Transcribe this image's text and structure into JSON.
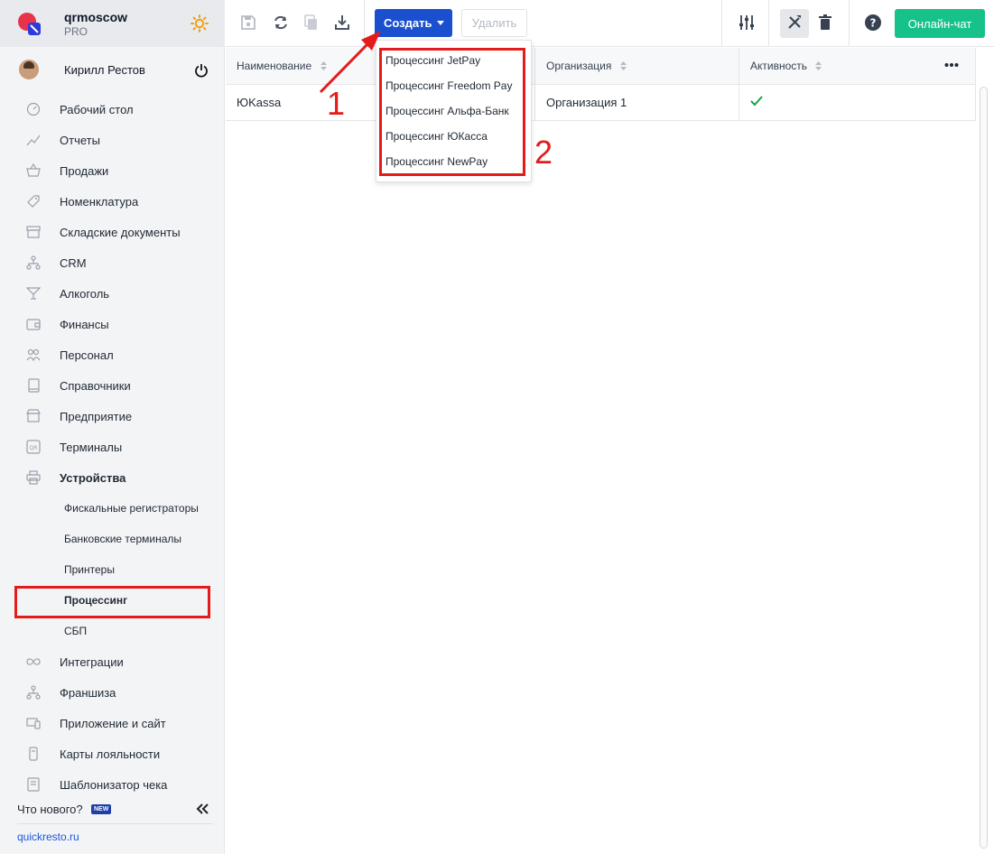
{
  "brand": {
    "name": "qrmoscow",
    "plan": "PRO"
  },
  "user": {
    "name": "Кирилл Рестов"
  },
  "nav": {
    "items": [
      {
        "label": "Рабочий стол",
        "icon": "dashboard-icon"
      },
      {
        "label": "Отчеты",
        "icon": "chart-icon"
      },
      {
        "label": "Продажи",
        "icon": "basket-icon"
      },
      {
        "label": "Номенклатура",
        "icon": "tag-icon"
      },
      {
        "label": "Складские документы",
        "icon": "archive-icon"
      },
      {
        "label": "CRM",
        "icon": "network-icon"
      },
      {
        "label": "Алкоголь",
        "icon": "cocktail-icon"
      },
      {
        "label": "Финансы",
        "icon": "wallet-icon"
      },
      {
        "label": "Персонал",
        "icon": "people-icon"
      },
      {
        "label": "Справочники",
        "icon": "book-icon"
      },
      {
        "label": "Предприятие",
        "icon": "store-icon"
      },
      {
        "label": "Терминалы",
        "icon": "qr-icon"
      },
      {
        "label": "Устройства",
        "icon": "printer-icon"
      }
    ],
    "sub_items": [
      {
        "label": "Фискальные регистраторы"
      },
      {
        "label": "Банковские терминалы"
      },
      {
        "label": "Принтеры"
      },
      {
        "label": "Процессинг"
      },
      {
        "label": "СБП"
      }
    ],
    "items_after": [
      {
        "label": "Интеграции",
        "icon": "infinity-icon"
      },
      {
        "label": "Франшиза",
        "icon": "network-icon"
      },
      {
        "label": "Приложение и сайт",
        "icon": "devices-icon"
      },
      {
        "label": "Карты лояльности",
        "icon": "card-icon"
      },
      {
        "label": "Шаблонизатор чека",
        "icon": "receipt-icon"
      }
    ],
    "whats_new": "Что нового?",
    "new_badge": "NEW",
    "site_link": "quickresto.ru"
  },
  "toolbar": {
    "create_label": "Создать",
    "delete_label": "Удалить",
    "chat_label": "Онлайн-чат"
  },
  "table": {
    "columns": [
      "Наименование",
      "Организация",
      "Активность"
    ],
    "rows": [
      {
        "name": "ЮKassa",
        "organization": "Организация 1",
        "active": true
      }
    ]
  },
  "dropdown": {
    "items": [
      "Процессинг JetPay",
      "Процессинг Freedom Pay",
      "Процессинг Альфа-Банк",
      "Процессинг ЮКасса",
      "Процессинг NewPay"
    ]
  },
  "annotations": {
    "step1": "1",
    "step2": "2"
  },
  "colors": {
    "accent": "#1a4fd0",
    "chat": "#17c28a",
    "highlight": "#e31b1b",
    "check": "#16a34a"
  }
}
